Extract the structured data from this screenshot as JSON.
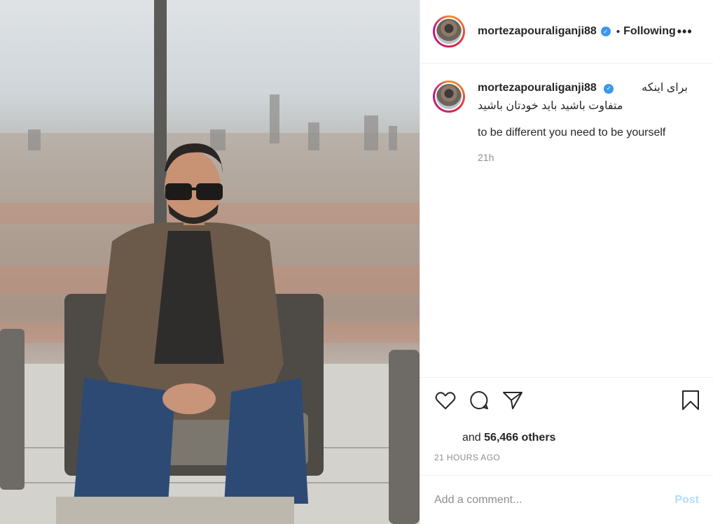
{
  "header": {
    "username": "mortezapouraliganji88",
    "separator": "•",
    "follow_label": "Following",
    "more_label": "•••"
  },
  "caption": {
    "username": "mortezapouraliganji88",
    "text_fa_line1": "برای اینکه",
    "text_fa_line2": "متفاوت باشید باید خودتان باشید",
    "text_en": "to be different you need to be yourself",
    "time": "21h"
  },
  "likes": {
    "prefix": "and",
    "count_text": "56,466 others"
  },
  "posted_ago": "21 HOURS AGO",
  "comment": {
    "placeholder": "Add a comment...",
    "post_label": "Post"
  },
  "colors": {
    "verified": "#3897f0",
    "post_disabled": "#b2dffc",
    "muted": "#8e8e8e"
  },
  "icons": {
    "like": "heart-icon",
    "comment": "comment-bubble-icon",
    "share": "paper-plane-icon",
    "save": "bookmark-icon",
    "verified": "verified-badge-icon"
  }
}
